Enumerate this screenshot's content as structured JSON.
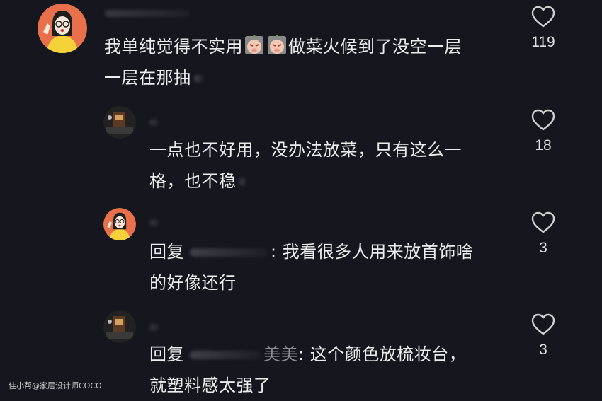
{
  "comments": [
    {
      "line1": "我单纯觉得不实用",
      "line1_after": "做菜火候到了没空一层",
      "line2": "一层在那抽",
      "likes": "119",
      "emojis": [
        "pig-face-emoji",
        "pig-face-emoji"
      ]
    },
    {
      "line1": "一点也不好用，没办法放菜，只有这么一",
      "line2": "格，也不稳",
      "likes": "18"
    },
    {
      "prefix": "回复",
      "line1_after": ": 我看很多人用来放首饰啥",
      "line2": "的好像还行",
      "likes": "3"
    },
    {
      "prefix": "回复",
      "reply_name": "美美",
      "line1_after": ": 这个颜色放梳妆台，",
      "line2": "就塑料感太强了",
      "likes": "3"
    }
  ],
  "watermark": "佳小帮@家居设计师COCO",
  "colors": {
    "background": "#16161e",
    "text": "#ececec",
    "icon": "#d0d0d0"
  }
}
